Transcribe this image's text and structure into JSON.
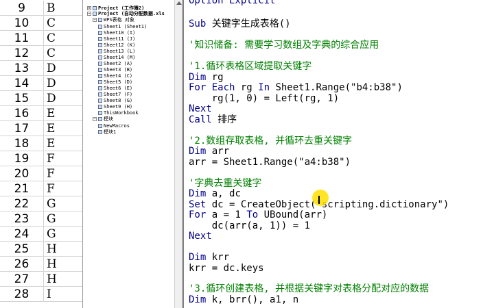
{
  "sheet": {
    "rows": [
      {
        "num": "9",
        "val": "B"
      },
      {
        "num": "10",
        "val": "C"
      },
      {
        "num": "11",
        "val": "C"
      },
      {
        "num": "12",
        "val": "C"
      },
      {
        "num": "13",
        "val": "D"
      },
      {
        "num": "14",
        "val": "D"
      },
      {
        "num": "15",
        "val": "D"
      },
      {
        "num": "16",
        "val": "E"
      },
      {
        "num": "17",
        "val": "E"
      },
      {
        "num": "18",
        "val": "E"
      },
      {
        "num": "19",
        "val": "F"
      },
      {
        "num": "20",
        "val": "F"
      },
      {
        "num": "21",
        "val": "F"
      },
      {
        "num": "22",
        "val": "G"
      },
      {
        "num": "23",
        "val": "G"
      },
      {
        "num": "24",
        "val": "G"
      },
      {
        "num": "25",
        "val": "H"
      },
      {
        "num": "26",
        "val": "H"
      },
      {
        "num": "27",
        "val": "H"
      },
      {
        "num": "28",
        "val": "I"
      }
    ]
  },
  "project": {
    "items": [
      {
        "label": "Project (工作簿2)",
        "bold": true
      },
      {
        "label": "Project (自动分配数据.xls",
        "bold": true
      },
      {
        "label": "WPS表格 对象"
      },
      {
        "label": "Sheet1 (Sheet1)"
      },
      {
        "label": "Sheet10 (I)"
      },
      {
        "label": "Sheet11 (J)"
      },
      {
        "label": "Sheet12 (K)"
      },
      {
        "label": "Sheet13 (L)"
      },
      {
        "label": "Sheet14 (M)"
      },
      {
        "label": "Sheet2 (A)"
      },
      {
        "label": "Sheet3 (B)"
      },
      {
        "label": "Sheet4 (C)"
      },
      {
        "label": "Sheet5 (D)"
      },
      {
        "label": "Sheet6 (E)"
      },
      {
        "label": "Sheet7 (F)"
      },
      {
        "label": "Sheet8 (G)"
      },
      {
        "label": "Sheet9 (H)"
      },
      {
        "label": "ThisWorkbook"
      },
      {
        "label": "模块"
      },
      {
        "label": "NewMacros"
      },
      {
        "label": "模块1"
      }
    ]
  },
  "code": {
    "l00": "Option Explicit",
    "l01_kw": "Sub",
    "l01_rest": " 关键字生成表格()",
    "l02": "'知识储备: 需要学习数组及字典的综合应用",
    "l03": "'1.循环表格区域提取关键字",
    "l04_kw": "Dim",
    "l04_rest": " rg",
    "l05_kw1": "For Each",
    "l05_mid": " rg ",
    "l05_kw2": "In",
    "l05_rest": " Sheet1.Range(\"b4:b38\")",
    "l06": "    rg(1, 0) = Left(rg, 1)",
    "l07_kw": "Next",
    "l08_kw": "Call",
    "l08_rest": " 排序",
    "l09": "'2.数组存取表格, 并循环去重关键字",
    "l10_kw": "Dim",
    "l10_rest": " arr",
    "l11": "arr = Sheet1.Range(\"a4:b38\")",
    "l12": "'字典去重关键字",
    "l13_kw": "Dim",
    "l13_rest": " a, dc",
    "l14_kw": "Set",
    "l14_rest": " dc = CreateObject(\"scripting.dictionary\")",
    "l15_kw1": "For",
    "l15_mid": " a = 1 ",
    "l15_kw2": "To",
    "l15_rest": " UBound(arr)",
    "l16": "    dc(arr(a, 1)) = 1",
    "l17_kw": "Next",
    "l18_kw": "Dim",
    "l18_rest": " krr",
    "l19": "krr = dc.keys",
    "l20": "'3.循环创建表格, 并根据关键字对表格分配对应的数据",
    "l21_kw": "Dim",
    "l21_rest": " k, brr(), a1, n"
  }
}
